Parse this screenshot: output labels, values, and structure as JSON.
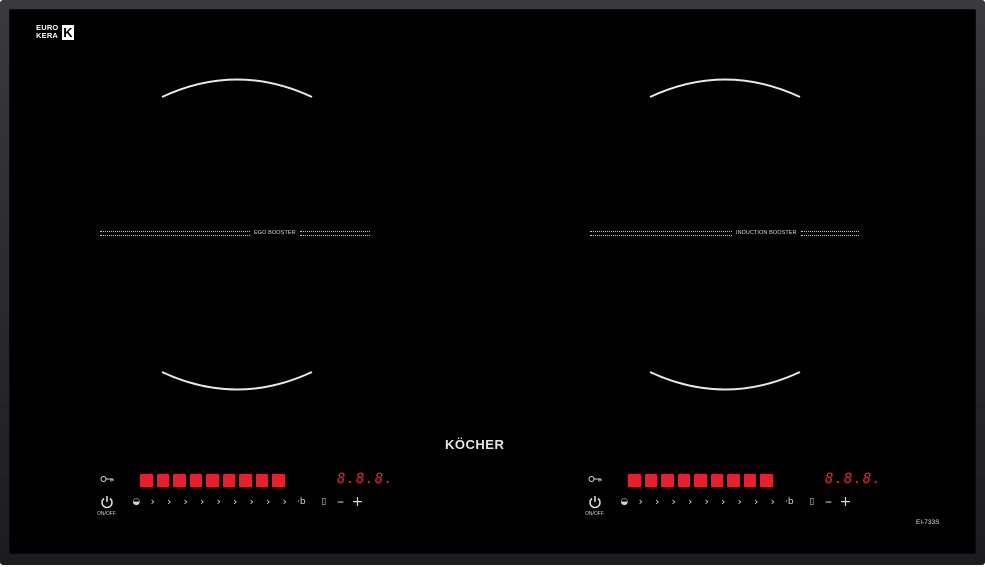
{
  "brand": {
    "name": "KÖCHER",
    "certification": "EURO KERA K"
  },
  "cert_lines": [
    "EURO",
    "KERA"
  ],
  "model": "EI-733S",
  "zones": [
    {
      "booster_label": "EGO BOOSTER"
    },
    {
      "booster_label": "INDUCTION BOOSTER"
    }
  ],
  "controls": [
    {
      "onoff_label": "ON/OFF",
      "display": "8.8.8.",
      "led_count": 9,
      "power_levels": [
        "›",
        "›",
        "›",
        "›",
        "›",
        "›",
        "›",
        "›",
        "›"
      ],
      "timer_symbol": "·b",
      "minus": "–",
      "plus": "+"
    },
    {
      "onoff_label": "ON/OFF",
      "display": "8.8.8.",
      "led_count": 9,
      "power_levels": [
        "›",
        "›",
        "›",
        "›",
        "›",
        "›",
        "›",
        "›",
        "›"
      ],
      "timer_symbol": "·b",
      "minus": "–",
      "plus": "+"
    }
  ],
  "icons": {
    "lock": "key-icon",
    "power": "power-icon",
    "half": "half-circle-icon",
    "timer": "timer-icon",
    "pause": "pause-icon"
  },
  "colors": {
    "glass": "#000000",
    "led": "#e8202c",
    "frame": "#2c2c2e"
  }
}
